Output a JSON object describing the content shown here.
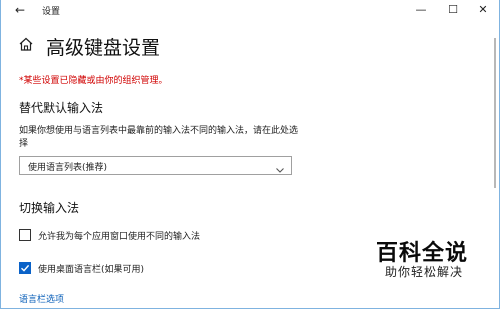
{
  "window": {
    "title": "设置",
    "back_glyph": "←",
    "minimize_glyph": "—",
    "maximize_glyph": "☐",
    "close_glyph": "✕"
  },
  "page": {
    "title": "高级键盘设置",
    "managed_note": "*某些设置已隐藏或由你的组织管理。"
  },
  "override_section": {
    "heading": "替代默认输入法",
    "description": "如果你想使用与语言列表中最靠前的输入法不同的输入法，请在此处选择",
    "dropdown_value": "使用语言列表(推荐)"
  },
  "switch_section": {
    "heading": "切换输入法",
    "checkbox1_label": "允许我为每个应用窗口使用不同的输入法",
    "checkbox1_checked": false,
    "checkbox2_label": "使用桌面语言栏(如果可用)",
    "checkbox2_checked": true
  },
  "links": {
    "language_bar_options": "语言栏选项"
  },
  "watermark": {
    "title": "百科全说",
    "subtitle": "助你轻松解决"
  },
  "colors": {
    "accent": "#0a62c8",
    "warning": "#d00000",
    "link": "#0a5fb8"
  }
}
